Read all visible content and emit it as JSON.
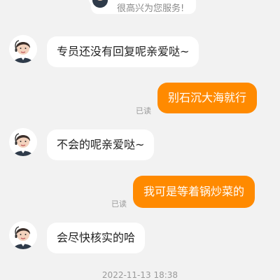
{
  "messages": [
    {
      "id": "m0",
      "direction": "in",
      "text": "很高兴为您服务!"
    },
    {
      "id": "m1",
      "direction": "in",
      "text": "专员还没有回复呢亲爱哒~"
    },
    {
      "id": "m2",
      "direction": "out",
      "text": "别石沉大海就行",
      "status": "已读"
    },
    {
      "id": "m3",
      "direction": "in",
      "text": "不会的呢亲爱哒~"
    },
    {
      "id": "m4",
      "direction": "out",
      "text": "我可是等着锅炒菜的",
      "status": "已读"
    },
    {
      "id": "m5",
      "direction": "in",
      "text": "会尽快核实的哈"
    }
  ],
  "timestamp": "2022-11-13 18:38",
  "colors": {
    "background": "#f2f2f2",
    "incoming_bubble": "#ffffff",
    "outgoing_bubble": "#ff8a00",
    "muted_text": "#9a9a9a"
  }
}
